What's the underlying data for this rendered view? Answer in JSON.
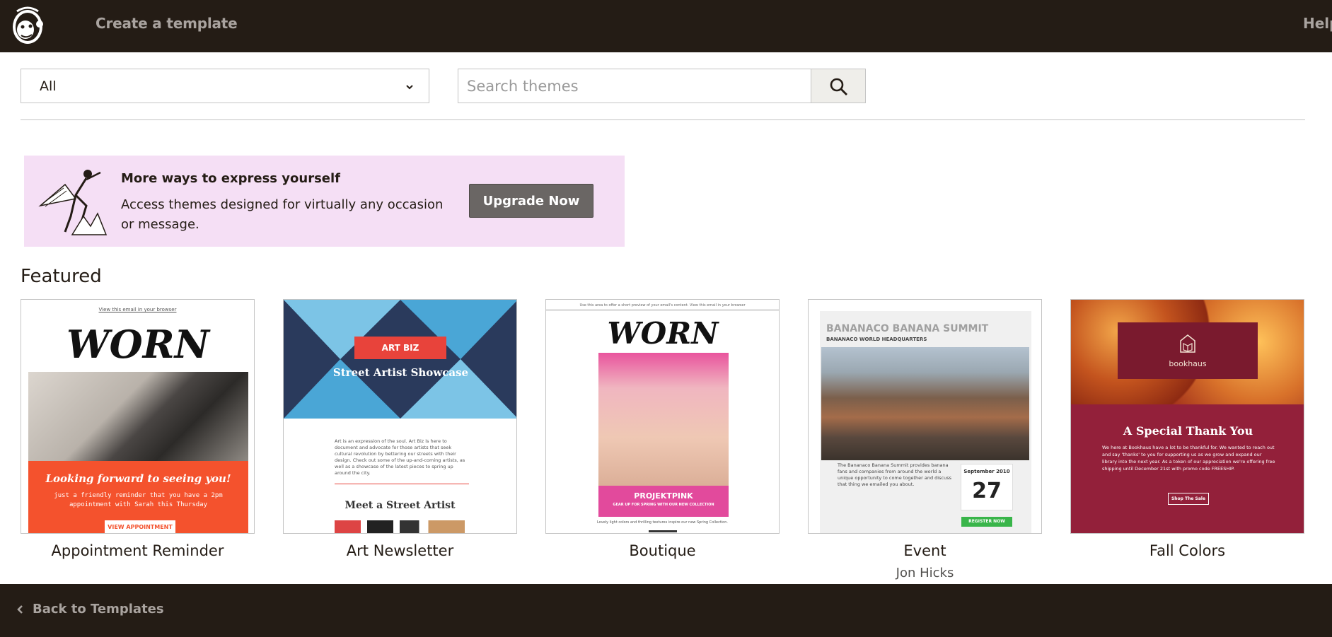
{
  "header": {
    "title": "Create a template",
    "help_label": "Help"
  },
  "filters": {
    "category_value": "All",
    "search_placeholder": "Search themes"
  },
  "banner": {
    "title": "More ways to express yourself",
    "text": "Access themes designed for virtually any occasion or message.",
    "button_label": "Upgrade Now"
  },
  "featured": {
    "heading": "Featured",
    "cards": [
      {
        "name": "Appointment Reminder",
        "author": "",
        "preview": {
          "link_text": "View this email in your browser",
          "brand": "WORN",
          "heading": "Looking forward to seeing you!",
          "body": "just a friendly reminder that you have a 2pm appointment with Sarah this Thursday",
          "button": "VIEW APPOINTMENT"
        }
      },
      {
        "name": "Art Newsletter",
        "author": "",
        "preview": {
          "logo": "ART BIZ",
          "title": "Street Artist Showcase",
          "body": "Art is an expression of the soul. Art Biz is here to document and advocate for those artists that seek cultural revolution by bettering our streets with their design. Check out some of the up-and-coming artists, as well as a showcase of the latest pieces to spring up around the city.",
          "subheading": "Meet a Street Artist"
        }
      },
      {
        "name": "Boutique",
        "author": "",
        "preview": {
          "top_text": "Use this area to offer a short preview of your email's content.   View this email in your browser",
          "brand": "WORN",
          "banner_title": "PROJEKTPINK",
          "banner_sub": "GEAR UP FOR SPRING WITH OUR NEW COLLECTION",
          "footer": "Lovely light colors and thrilling textures inspire our new Spring Collection."
        }
      },
      {
        "name": "Event",
        "author": "Jon Hicks",
        "preview": {
          "title": "BANANACO BANANA SUMMIT",
          "subtitle": "BANANACO WORLD HEADQUARTERS",
          "body": "The Bananaco Banana Summit provides banana fans and companies from around the world a unique opportunity to come together and discuss that thing we emailed you about.",
          "month": "September 2010",
          "day": "27",
          "button": "REGISTER NOW"
        }
      },
      {
        "name": "Fall Colors",
        "author": "",
        "preview": {
          "brand": "bookhaus",
          "heading": "A Special Thank You",
          "body": "We here at Bookhaus have a lot to be thankful for. We wanted to reach out and say 'thanks' to you for supporting us as we grow and expand our library into the next year. As a token of our appreciation we're offering free shipping until December 21st with promo code FREESHIP.",
          "button": "Shop The Sale"
        }
      }
    ]
  },
  "footer": {
    "back_label": "Back to Templates"
  },
  "colors": {
    "chrome": "#241c15",
    "banner_bg": "#f5dff5",
    "upgrade_button": "#6a6664"
  }
}
